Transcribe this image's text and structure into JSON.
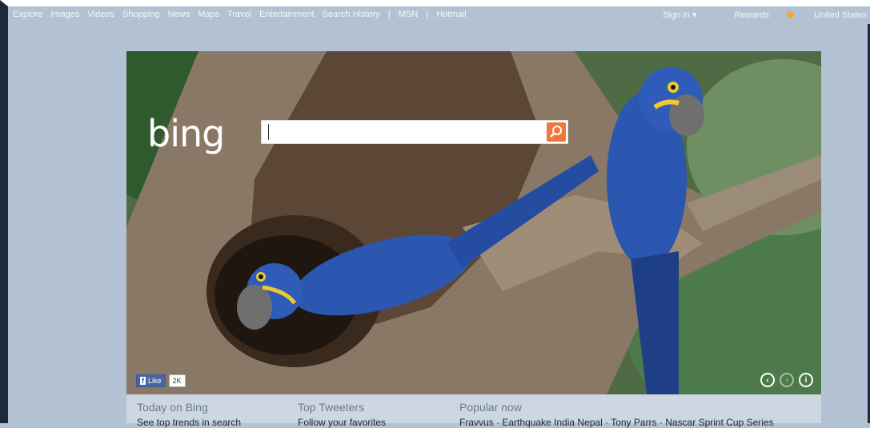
{
  "topbar": {
    "nav": [
      "Explore",
      "Images",
      "Videos",
      "Shopping",
      "News",
      "Maps",
      "Travel",
      "Entertainment",
      "Search History"
    ],
    "nav_extra": [
      "MSN",
      "Hotmail"
    ],
    "separator": "|",
    "sign_in": "Sign in ▾",
    "rewards": "Rewards",
    "region": "United States"
  },
  "hero": {
    "logo": "bing",
    "search_value": "",
    "like_label": "Like",
    "like_count": "2K",
    "icons": [
      "prev-arrow-icon",
      "next-arrow-icon",
      "info-icon"
    ]
  },
  "bottom": {
    "col1_title": "Today on Bing",
    "col1_text": "See top trends in search",
    "col2_title": "Top Tweeters",
    "col2_text": "Follow your favorites",
    "col3_title": "Popular now",
    "col3_text": "Fravvus · Earthquake India Nepal · Tony Parrs · Nascar Sprint Cup Series"
  },
  "colors": {
    "page_bg": "#b3c2d3",
    "search_button": "#f1763a",
    "bottom_bg": "#cdd7e2",
    "macaw_blue": "#2b57b0"
  }
}
